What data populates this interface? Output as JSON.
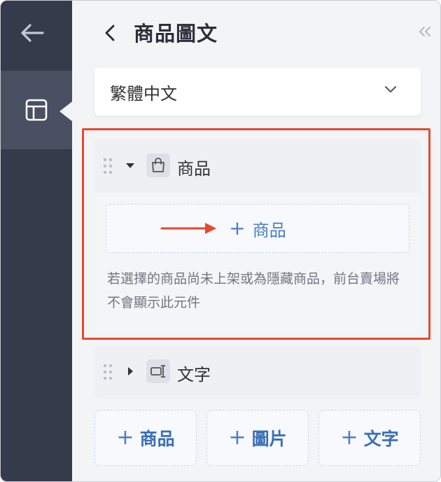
{
  "header": {
    "title": "商品圖文"
  },
  "language_select": {
    "value": "繁體中文"
  },
  "sections": {
    "products": {
      "label": "商品",
      "add_label": "商品",
      "hint": "若選擇的商品尚未上架或為隱藏商品，前台賣場將不會顯示此元件"
    },
    "text": {
      "label": "文字"
    }
  },
  "add_buttons": {
    "product": "商品",
    "image": "圖片",
    "text": "文字"
  },
  "icons": {
    "rail_back": "arrow-left-icon",
    "rail_layout": "layout-icon",
    "header_back": "chevron-left-icon",
    "collapse": "double-chevron-left-icon",
    "dropdown": "chevron-down-icon",
    "grip": "drag-handle-icon",
    "product_type": "shopping-bag-icon",
    "text_type": "text-cursor-icon"
  },
  "colors": {
    "rail": "#363b4c",
    "rail_active": "#4a5062",
    "accent": "#4a7ec5",
    "highlight": "#e5492f"
  }
}
